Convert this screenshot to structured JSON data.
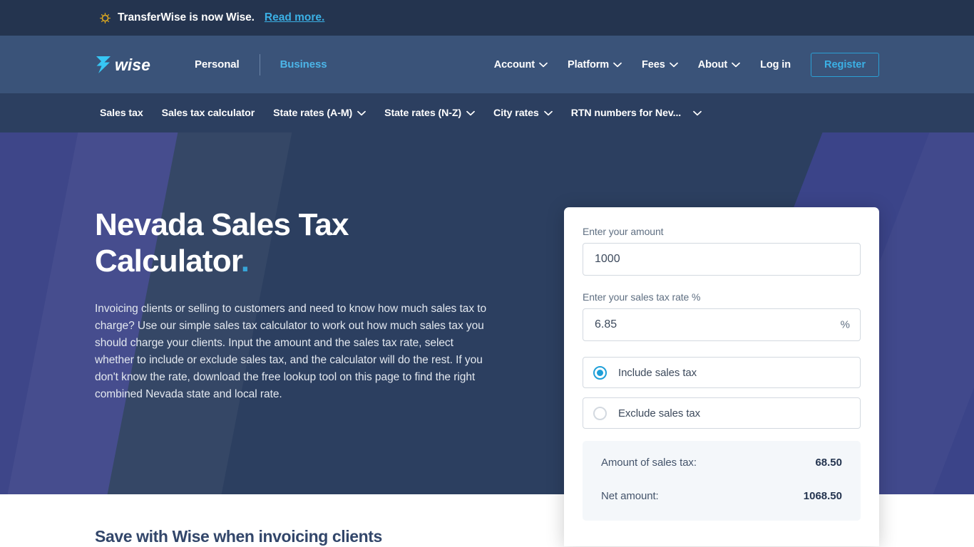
{
  "banner": {
    "icon": "sun-icon",
    "text": "TransferWise is now Wise.",
    "link_label": "Read more."
  },
  "header": {
    "logo_alt": "wise-logo",
    "links": [
      {
        "label": "Personal",
        "active": false
      },
      {
        "label": "Business",
        "active": true
      }
    ],
    "nav": [
      {
        "label": "Account",
        "has_chevron": true
      },
      {
        "label": "Platform",
        "has_chevron": true
      },
      {
        "label": "Fees",
        "has_chevron": true
      },
      {
        "label": "About",
        "has_chevron": true
      },
      {
        "label": "Log in",
        "has_chevron": false
      }
    ],
    "register_label": "Register"
  },
  "subnav": {
    "items": [
      {
        "label": "Sales tax",
        "has_chevron": false
      },
      {
        "label": "Sales tax calculator",
        "has_chevron": false
      },
      {
        "label": "State rates (A-M)",
        "has_chevron": true
      },
      {
        "label": "State rates (N-Z)",
        "has_chevron": true
      },
      {
        "label": "City rates",
        "has_chevron": true
      },
      {
        "label": "RTN numbers for Nev...",
        "has_chevron": true
      }
    ]
  },
  "hero": {
    "title_line1": "Nevada Sales Tax",
    "title_line2": "Calculator",
    "title_dot": ".",
    "paragraph": "Invoicing clients or selling to customers and need to know how much sales tax to charge? Use our simple sales tax calculator to work out how much sales tax you should charge your clients. Input the amount and the sales tax rate, select whether to include or exclude sales tax, and the calculator will do the rest. If you don't know the rate, download the free lookup tool on this page to find the right combined Nevada state and local rate."
  },
  "calculator": {
    "amount_label": "Enter your amount",
    "amount_value": "1000",
    "amount_placeholder": "Enter your amount",
    "rate_label": "Enter your sales tax rate %",
    "rate_value": "6.85",
    "rate_placeholder": "Enter your sales tax rate",
    "percent_suffix": "%",
    "options": [
      {
        "label": "Include sales tax",
        "selected": true
      },
      {
        "label": "Exclude sales tax",
        "selected": false
      }
    ],
    "results": [
      {
        "label": "Amount of sales tax:",
        "value": "68.50"
      },
      {
        "label": "Net amount:",
        "value": "1068.50"
      }
    ]
  },
  "below_section": {
    "heading": "Save with Wise when invoicing clients"
  },
  "colors": {
    "banner_bg": "#24344f",
    "header_bg": "#3a5379",
    "subnav_bg": "#2c3f60",
    "hero_bg": "#2c3f60",
    "accent_cyan": "#3bb0e5",
    "accent_purple": "#3e4689",
    "radio_blue": "#1e9fd8",
    "heading_blue": "#32466a",
    "results_bg": "#f4f7fa",
    "sun_gold": "#d8a520"
  }
}
